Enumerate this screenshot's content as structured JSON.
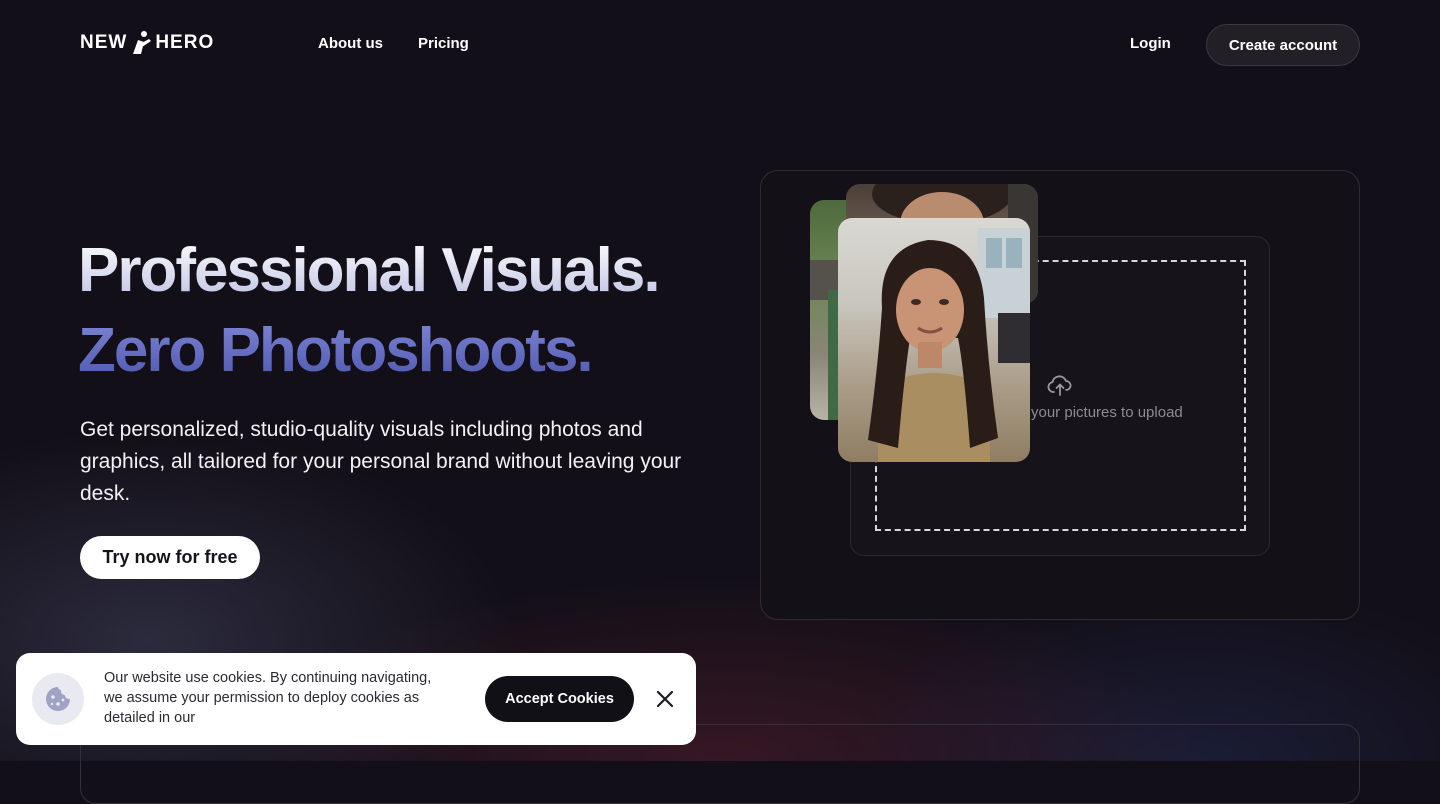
{
  "nav": {
    "logo_left": "NEW",
    "logo_right": "HERO",
    "links": [
      {
        "label": "About us"
      },
      {
        "label": "Pricing"
      }
    ],
    "login_label": "Login",
    "create_account_label": "Create account"
  },
  "hero": {
    "title_line1": "Professional Visuals.",
    "title_line2": "Zero Photoshoots.",
    "subtitle": "Get personalized, studio-quality visuals including photos and graphics, all tailored for your personal brand without leaving your desk.",
    "cta_label": "Try now for free"
  },
  "upload_demo": {
    "hint_text": "your pictures to upload",
    "icon": "cloud-upload-icon"
  },
  "cookie_banner": {
    "text": "Our website use cookies. By continuing navigating, we assume your permission to deploy cookies as detailed in our",
    "accept_label": "Accept Cookies",
    "icon": "cookie-icon",
    "close_icon": "close-icon"
  },
  "colors": {
    "background": "#130f18",
    "accent_indigo": "#5e67c0",
    "title_light": "#c6c8e8"
  }
}
